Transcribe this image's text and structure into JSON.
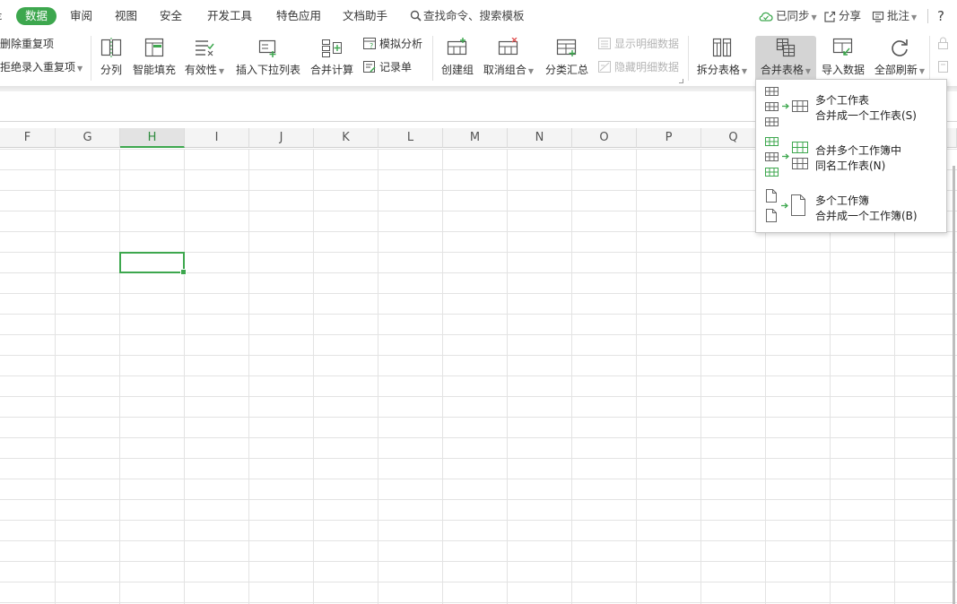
{
  "menu_tabs": [
    {
      "label": "数据",
      "active": true
    },
    {
      "label": "审阅"
    },
    {
      "label": "视图"
    },
    {
      "label": "安全"
    },
    {
      "label": "开发工具"
    },
    {
      "label": "特色应用"
    },
    {
      "label": "文档助手"
    }
  ],
  "search": {
    "label": "查找命令、搜索模板"
  },
  "topright": {
    "synced": "已同步",
    "share": "分享",
    "comment": "批注",
    "help": "?"
  },
  "ribbon": {
    "delete_dup": "删除重复项",
    "reject_dup": "拒绝录入重复项",
    "split_col": "分列",
    "smart_fill": "智能填充",
    "validity": "有效性",
    "insert_dropdown": "插入下拉列表",
    "merge_calc": "合并计算",
    "simulate": "模拟分析",
    "record_form": "记录单",
    "create_group": "创建组",
    "ungroup": "取消组合",
    "subtotal": "分类汇总",
    "show_detail": "显示明细数据",
    "hide_detail": "隐藏明细数据",
    "split_table": "拆分表格",
    "merge_table": "合并表格",
    "import_data": "导入数据",
    "refresh_all": "全部刷新"
  },
  "columns": [
    "F",
    "G",
    "H",
    "I",
    "J",
    "K",
    "L",
    "M",
    "N",
    "O",
    "P",
    "Q"
  ],
  "selected_column": "H",
  "merge_menu": [
    {
      "line1": "多个工作表",
      "line2": "合并成一个工作表(S)",
      "icon": "sheets-merge-icon"
    },
    {
      "line1": "合并多个工作簿中",
      "line2": "同名工作表(N)",
      "icon": "workbooks-same-name-icon"
    },
    {
      "line1": "多个工作簿",
      "line2": "合并成一个工作簿(B)",
      "icon": "workbooks-merge-icon"
    }
  ],
  "colors": {
    "accent": "#3da74e",
    "hover": "#d4d4d4",
    "disabled": "#b5b5b5"
  }
}
